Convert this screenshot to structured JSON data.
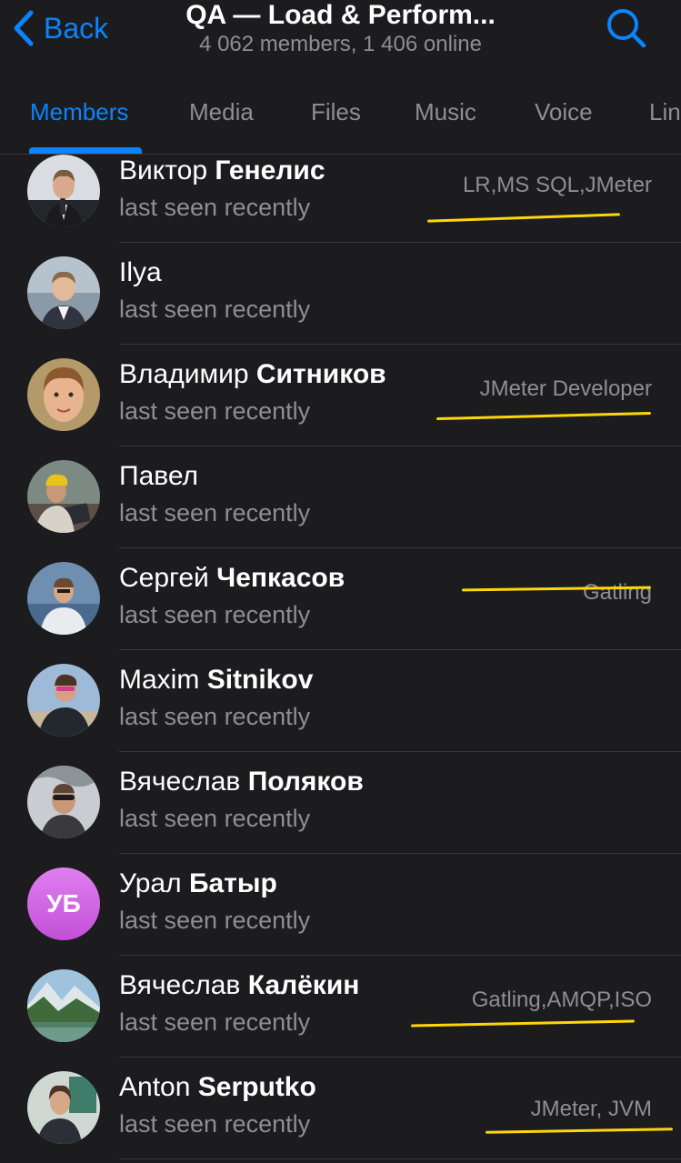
{
  "header": {
    "back_label": "Back",
    "title": "QA — Load & Perform...",
    "subtitle": "4 062 members, 1 406 online"
  },
  "tabs": [
    {
      "label": "Members"
    },
    {
      "label": "Media"
    },
    {
      "label": "Files"
    },
    {
      "label": "Music"
    },
    {
      "label": "Voice"
    },
    {
      "label": "Lin"
    }
  ],
  "colors": {
    "accent": "#0a84ff",
    "highlight": "#ffd60a",
    "background": "#1c1c1e"
  },
  "members": [
    {
      "first": "Виктор",
      "last": "Генелис",
      "status": "last seen recently",
      "rank": "LR,MS SQL,JMeter",
      "avatar_icon": "photo"
    },
    {
      "first": "Ilya",
      "last": "",
      "status": "last seen recently",
      "rank": "",
      "avatar_icon": "photo"
    },
    {
      "first": "Владимир",
      "last": "Ситников",
      "status": "last seen recently",
      "rank": "JMeter Developer",
      "avatar_icon": "photo"
    },
    {
      "first": "Павел",
      "last": "",
      "status": "last seen recently",
      "rank": "",
      "avatar_icon": "photo"
    },
    {
      "first": "Сергей",
      "last": "Чепкасов",
      "status": "last seen recently",
      "rank": "Gatling",
      "avatar_icon": "photo"
    },
    {
      "first": "Maxim",
      "last": "Sitnikov",
      "status": "last seen recently",
      "rank": "",
      "avatar_icon": "photo"
    },
    {
      "first": "Вячеслав",
      "last": "Поляков",
      "status": "last seen recently",
      "rank": "",
      "avatar_icon": "photo"
    },
    {
      "first": "Урал",
      "last": "Батыр",
      "status": "last seen recently",
      "rank": "",
      "avatar_initials": "УБ"
    },
    {
      "first": "Вячеслав",
      "last": "Калёкин",
      "status": "last seen recently",
      "rank": "Gatling,AMQP,ISO",
      "avatar_icon": "photo"
    },
    {
      "first": "Anton",
      "last": "Serputko",
      "status": "last seen recently",
      "rank": "JMeter, JVM",
      "avatar_icon": "photo"
    }
  ]
}
